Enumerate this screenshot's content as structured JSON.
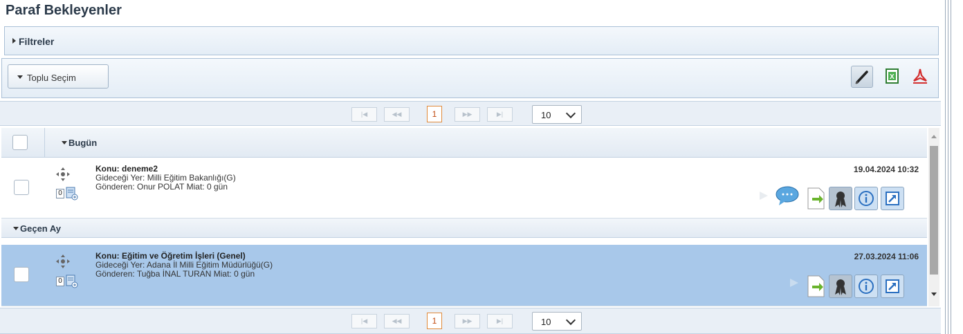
{
  "page": {
    "title": "Paraf Bekleyenler"
  },
  "filters": {
    "label": "Filtreler"
  },
  "toolbar": {
    "bulk_select_label": "Toplu Seçim",
    "icons": [
      "pen-icon",
      "excel-icon",
      "pdf-icon"
    ]
  },
  "pager": {
    "current_page": "1",
    "page_size": "10"
  },
  "grid": {
    "groups": [
      {
        "label": "Bugün",
        "rows": [
          {
            "subject": "Konu: deneme2",
            "destination": "Gideceği Yer: Milli Eğitim Bakanlığı(G)",
            "sender": "Gönderen: Onur POLAT Miat: 0 gün",
            "datetime": "19.04.2024 10:32",
            "attachment_count": "0",
            "selected": false
          }
        ]
      },
      {
        "label": "Geçen Ay",
        "rows": [
          {
            "subject": "Konu: Eğitim ve Öğretim İşleri (Genel)",
            "destination": "Gideceği Yer: Adana İl Milli Eğitim Müdürlüğü(G)",
            "sender": "Gönderen: Tuğba İNAL TURAN Miat: 0 gün",
            "datetime": "27.03.2024 11:06",
            "attachment_count": "0",
            "selected": true
          }
        ]
      }
    ]
  },
  "colors": {
    "selected_row": "#a8c8ea",
    "header_text": "#2b3a4a",
    "pager_active": "#e08a3a"
  }
}
